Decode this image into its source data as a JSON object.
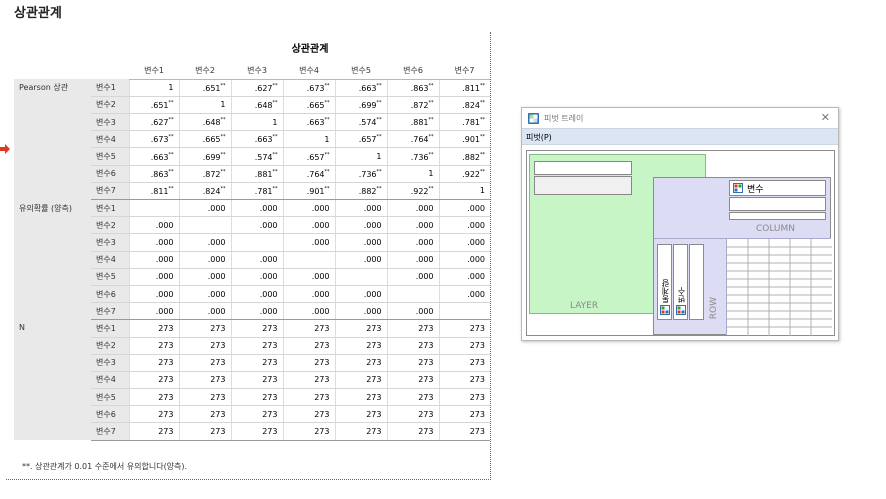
{
  "heading": "상관관계",
  "table": {
    "title": "상관관계",
    "columns": [
      "변수1",
      "변수2",
      "변수3",
      "변수4",
      "변수5",
      "변수6",
      "변수7"
    ],
    "groups": [
      {
        "label": "Pearson 상관",
        "rows": [
          {
            "label": "변수1",
            "cells": [
              {
                "v": "1",
                "s": ""
              },
              {
                "v": ".651",
                "s": "**"
              },
              {
                "v": ".627",
                "s": "**"
              },
              {
                "v": ".673",
                "s": "**"
              },
              {
                "v": ".663",
                "s": "**"
              },
              {
                "v": ".863",
                "s": "**"
              },
              {
                "v": ".811",
                "s": "**"
              }
            ]
          },
          {
            "label": "변수2",
            "cells": [
              {
                "v": ".651",
                "s": "**"
              },
              {
                "v": "1",
                "s": ""
              },
              {
                "v": ".648",
                "s": "**"
              },
              {
                "v": ".665",
                "s": "**"
              },
              {
                "v": ".699",
                "s": "**"
              },
              {
                "v": ".872",
                "s": "**"
              },
              {
                "v": ".824",
                "s": "**"
              }
            ]
          },
          {
            "label": "변수3",
            "cells": [
              {
                "v": ".627",
                "s": "**"
              },
              {
                "v": ".648",
                "s": "**"
              },
              {
                "v": "1",
                "s": ""
              },
              {
                "v": ".663",
                "s": "**"
              },
              {
                "v": ".574",
                "s": "**"
              },
              {
                "v": ".881",
                "s": "**"
              },
              {
                "v": ".781",
                "s": "**"
              }
            ]
          },
          {
            "label": "변수4",
            "cells": [
              {
                "v": ".673",
                "s": "**"
              },
              {
                "v": ".665",
                "s": "**"
              },
              {
                "v": ".663",
                "s": "**"
              },
              {
                "v": "1",
                "s": ""
              },
              {
                "v": ".657",
                "s": "**"
              },
              {
                "v": ".764",
                "s": "**"
              },
              {
                "v": ".901",
                "s": "**"
              }
            ]
          },
          {
            "label": "변수5",
            "cells": [
              {
                "v": ".663",
                "s": "**"
              },
              {
                "v": ".699",
                "s": "**"
              },
              {
                "v": ".574",
                "s": "**"
              },
              {
                "v": ".657",
                "s": "**"
              },
              {
                "v": "1",
                "s": ""
              },
              {
                "v": ".736",
                "s": "**"
              },
              {
                "v": ".882",
                "s": "**"
              }
            ]
          },
          {
            "label": "변수6",
            "cells": [
              {
                "v": ".863",
                "s": "**"
              },
              {
                "v": ".872",
                "s": "**"
              },
              {
                "v": ".881",
                "s": "**"
              },
              {
                "v": ".764",
                "s": "**"
              },
              {
                "v": ".736",
                "s": "**"
              },
              {
                "v": "1",
                "s": ""
              },
              {
                "v": ".922",
                "s": "**"
              }
            ]
          },
          {
            "label": "변수7",
            "cells": [
              {
                "v": ".811",
                "s": "**"
              },
              {
                "v": ".824",
                "s": "**"
              },
              {
                "v": ".781",
                "s": "**"
              },
              {
                "v": ".901",
                "s": "**"
              },
              {
                "v": ".882",
                "s": "**"
              },
              {
                "v": ".922",
                "s": "**"
              },
              {
                "v": "1",
                "s": ""
              }
            ]
          }
        ]
      },
      {
        "label": "유의확률 (양측)",
        "rows": [
          {
            "label": "변수1",
            "cells": [
              {
                "v": "",
                "s": ""
              },
              {
                "v": ".000",
                "s": ""
              },
              {
                "v": ".000",
                "s": ""
              },
              {
                "v": ".000",
                "s": ""
              },
              {
                "v": ".000",
                "s": ""
              },
              {
                "v": ".000",
                "s": ""
              },
              {
                "v": ".000",
                "s": ""
              }
            ]
          },
          {
            "label": "변수2",
            "cells": [
              {
                "v": ".000",
                "s": ""
              },
              {
                "v": "",
                "s": ""
              },
              {
                "v": ".000",
                "s": ""
              },
              {
                "v": ".000",
                "s": ""
              },
              {
                "v": ".000",
                "s": ""
              },
              {
                "v": ".000",
                "s": ""
              },
              {
                "v": ".000",
                "s": ""
              }
            ]
          },
          {
            "label": "변수3",
            "cells": [
              {
                "v": ".000",
                "s": ""
              },
              {
                "v": ".000",
                "s": ""
              },
              {
                "v": "",
                "s": ""
              },
              {
                "v": ".000",
                "s": ""
              },
              {
                "v": ".000",
                "s": ""
              },
              {
                "v": ".000",
                "s": ""
              },
              {
                "v": ".000",
                "s": ""
              }
            ]
          },
          {
            "label": "변수4",
            "cells": [
              {
                "v": ".000",
                "s": ""
              },
              {
                "v": ".000",
                "s": ""
              },
              {
                "v": ".000",
                "s": ""
              },
              {
                "v": "",
                "s": ""
              },
              {
                "v": ".000",
                "s": ""
              },
              {
                "v": ".000",
                "s": ""
              },
              {
                "v": ".000",
                "s": ""
              }
            ]
          },
          {
            "label": "변수5",
            "cells": [
              {
                "v": ".000",
                "s": ""
              },
              {
                "v": ".000",
                "s": ""
              },
              {
                "v": ".000",
                "s": ""
              },
              {
                "v": ".000",
                "s": ""
              },
              {
                "v": "",
                "s": ""
              },
              {
                "v": ".000",
                "s": ""
              },
              {
                "v": ".000",
                "s": ""
              }
            ]
          },
          {
            "label": "변수6",
            "cells": [
              {
                "v": ".000",
                "s": ""
              },
              {
                "v": ".000",
                "s": ""
              },
              {
                "v": ".000",
                "s": ""
              },
              {
                "v": ".000",
                "s": ""
              },
              {
                "v": ".000",
                "s": ""
              },
              {
                "v": "",
                "s": ""
              },
              {
                "v": ".000",
                "s": ""
              }
            ]
          },
          {
            "label": "변수7",
            "cells": [
              {
                "v": ".000",
                "s": ""
              },
              {
                "v": ".000",
                "s": ""
              },
              {
                "v": ".000",
                "s": ""
              },
              {
                "v": ".000",
                "s": ""
              },
              {
                "v": ".000",
                "s": ""
              },
              {
                "v": ".000",
                "s": ""
              },
              {
                "v": "",
                "s": ""
              }
            ]
          }
        ]
      },
      {
        "label": "N",
        "rows": [
          {
            "label": "변수1",
            "cells": [
              {
                "v": "273",
                "s": ""
              },
              {
                "v": "273",
                "s": ""
              },
              {
                "v": "273",
                "s": ""
              },
              {
                "v": "273",
                "s": ""
              },
              {
                "v": "273",
                "s": ""
              },
              {
                "v": "273",
                "s": ""
              },
              {
                "v": "273",
                "s": ""
              }
            ]
          },
          {
            "label": "변수2",
            "cells": [
              {
                "v": "273",
                "s": ""
              },
              {
                "v": "273",
                "s": ""
              },
              {
                "v": "273",
                "s": ""
              },
              {
                "v": "273",
                "s": ""
              },
              {
                "v": "273",
                "s": ""
              },
              {
                "v": "273",
                "s": ""
              },
              {
                "v": "273",
                "s": ""
              }
            ]
          },
          {
            "label": "변수3",
            "cells": [
              {
                "v": "273",
                "s": ""
              },
              {
                "v": "273",
                "s": ""
              },
              {
                "v": "273",
                "s": ""
              },
              {
                "v": "273",
                "s": ""
              },
              {
                "v": "273",
                "s": ""
              },
              {
                "v": "273",
                "s": ""
              },
              {
                "v": "273",
                "s": ""
              }
            ]
          },
          {
            "label": "변수4",
            "cells": [
              {
                "v": "273",
                "s": ""
              },
              {
                "v": "273",
                "s": ""
              },
              {
                "v": "273",
                "s": ""
              },
              {
                "v": "273",
                "s": ""
              },
              {
                "v": "273",
                "s": ""
              },
              {
                "v": "273",
                "s": ""
              },
              {
                "v": "273",
                "s": ""
              }
            ]
          },
          {
            "label": "변수5",
            "cells": [
              {
                "v": "273",
                "s": ""
              },
              {
                "v": "273",
                "s": ""
              },
              {
                "v": "273",
                "s": ""
              },
              {
                "v": "273",
                "s": ""
              },
              {
                "v": "273",
                "s": ""
              },
              {
                "v": "273",
                "s": ""
              },
              {
                "v": "273",
                "s": ""
              }
            ]
          },
          {
            "label": "변수6",
            "cells": [
              {
                "v": "273",
                "s": ""
              },
              {
                "v": "273",
                "s": ""
              },
              {
                "v": "273",
                "s": ""
              },
              {
                "v": "273",
                "s": ""
              },
              {
                "v": "273",
                "s": ""
              },
              {
                "v": "273",
                "s": ""
              },
              {
                "v": "273",
                "s": ""
              }
            ]
          },
          {
            "label": "변수7",
            "cells": [
              {
                "v": "273",
                "s": ""
              },
              {
                "v": "273",
                "s": ""
              },
              {
                "v": "273",
                "s": ""
              },
              {
                "v": "273",
                "s": ""
              },
              {
                "v": "273",
                "s": ""
              },
              {
                "v": "273",
                "s": ""
              },
              {
                "v": "273",
                "s": ""
              }
            ]
          }
        ]
      }
    ],
    "footnote": "**. 상관관계가 0.01 수준에서 유의합니다(양측)."
  },
  "pivot_tray": {
    "title": "피벗 트레이",
    "close_icon": "close-icon",
    "menu_item": "피벗(P)",
    "layer_label": "LAYER",
    "column_label": "COLUMN",
    "row_label": "ROW",
    "column_item": "변수",
    "row_items": [
      "통계량",
      "변수"
    ]
  },
  "colors": {
    "layer_bg": "#c8f5c5",
    "pane_bg": "#dcdcf5",
    "menubar_bg": "#dce6f2",
    "selection_marker": "#e03a1e"
  }
}
